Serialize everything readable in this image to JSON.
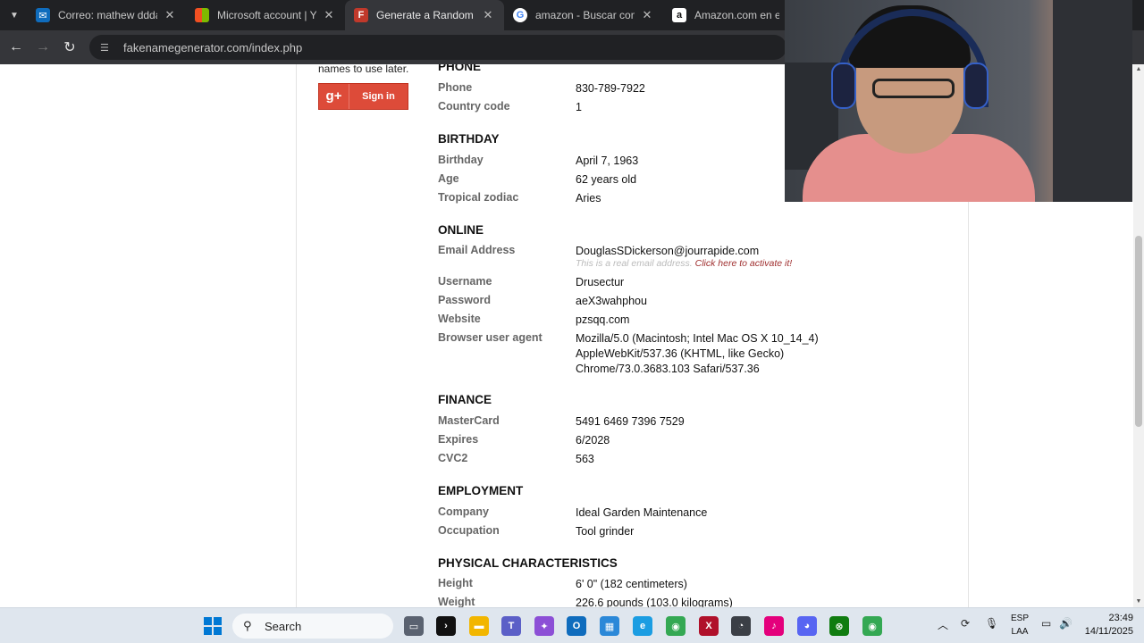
{
  "browser": {
    "tabs": [
      {
        "label": "Correo: mathew dddan - O",
        "favicon": "outlook-mail-icon",
        "color": "#0f6cbd"
      },
      {
        "label": "Microsoft account | Your p",
        "favicon": "microsoft-icon",
        "color": "#f25022"
      },
      {
        "label": "Generate a Random Name",
        "favicon": "fakename-f-icon",
        "color": "#c0392b",
        "glyph": "F",
        "active": true
      },
      {
        "label": "amazon - Buscar con Goog",
        "favicon": "google-icon",
        "color": "#4285f4",
        "glyph": "G"
      },
      {
        "label": "Amazon.com en español",
        "favicon": "amazon-icon",
        "color": "#ffffff",
        "glyph": "a"
      }
    ],
    "url": "fakenamegenerator.com/index.php"
  },
  "sidebar": {
    "note": "names to use later.",
    "gplus_glyph": "g+",
    "signin_label": "Sign in"
  },
  "sections": {
    "phone": {
      "title": "PHONE",
      "phone_label": "Phone",
      "phone_value": "830-789-7922",
      "cc_label": "Country code",
      "cc_value": "1"
    },
    "birthday": {
      "title": "BIRTHDAY",
      "bday_label": "Birthday",
      "bday_value": "April 7, 1963",
      "age_label": "Age",
      "age_value": "62 years old",
      "zodiac_label": "Tropical zodiac",
      "zodiac_value": "Aries"
    },
    "online": {
      "title": "ONLINE",
      "email_label": "Email Address",
      "email_value": "DouglasSDickerson@jourrapide.com",
      "email_note": "This is a real email address.",
      "email_link": "Click here to activate it!",
      "user_label": "Username",
      "user_value": "Drusectur",
      "pass_label": "Password",
      "pass_value": "aeX3wahphou",
      "web_label": "Website",
      "web_value": "pzsqq.com",
      "ua_label": "Browser user agent",
      "ua_line1": "Mozilla/5.0 (Macintosh; Intel Mac OS X 10_14_4)",
      "ua_line2": "AppleWebKit/537.36 (KHTML, like Gecko)",
      "ua_line3": "Chrome/73.0.3683.103 Safari/537.36"
    },
    "finance": {
      "title": "FINANCE",
      "mc_label": "MasterCard",
      "mc_value": "5491 6469 7396 7529",
      "exp_label": "Expires",
      "exp_value": "6/2028",
      "cvc_label": "CVC2",
      "cvc_value": "563"
    },
    "employment": {
      "title": "EMPLOYMENT",
      "company_label": "Company",
      "company_value": "Ideal Garden Maintenance",
      "occ_label": "Occupation",
      "occ_value": "Tool grinder"
    },
    "physical": {
      "title": "PHYSICAL CHARACTERISTICS",
      "height_label": "Height",
      "height_value": "6' 0\" (182 centimeters)",
      "weight_label": "Weight",
      "weight_value": "226.6 pounds (103.0 kilograms)"
    }
  },
  "taskbar": {
    "search_label": "Search",
    "lang_line1": "ESP",
    "lang_line2": "LAA",
    "time": "23:49",
    "date": "14/11/2025"
  }
}
